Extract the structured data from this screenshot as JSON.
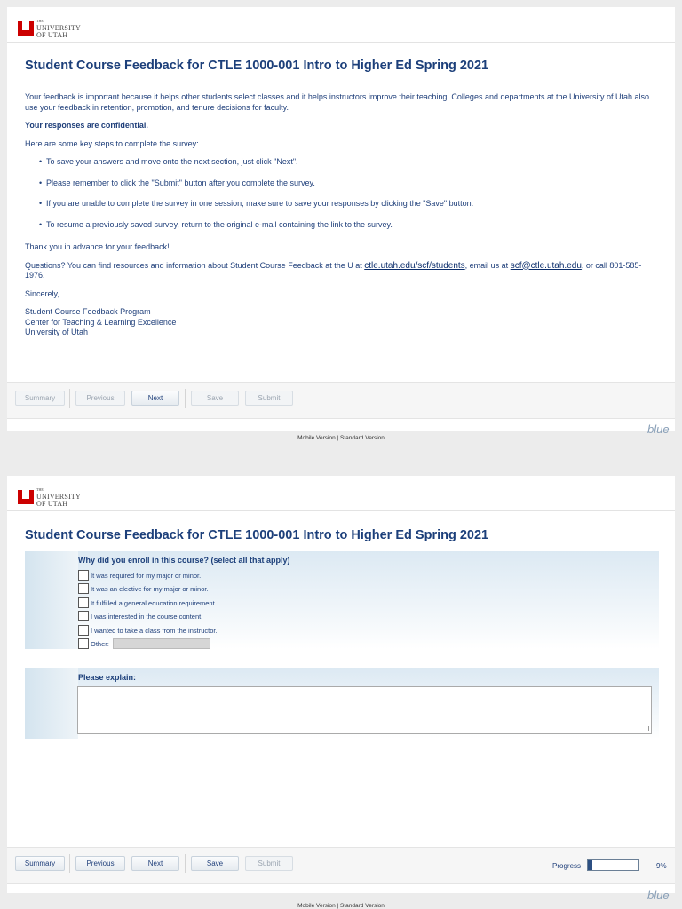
{
  "logo": {
    "the": "THE",
    "line1": "UNIVERSITY",
    "line2": "OF UTAH"
  },
  "title": "Student Course Feedback for CTLE 1000-001 Intro to Higher Ed Spring 2021",
  "intro": {
    "p1": "Your feedback is important because it helps other students select classes and it helps instructors improve their teaching. Colleges and departments at the University of Utah also use your feedback in retention, promotion, and tenure decisions for faculty.",
    "confidential": "Your responses are confidential.",
    "steps_heading": "Here are some key steps to complete the survey:",
    "steps": [
      "To save your answers and move onto the next section, just click \"Next\".",
      "Please remember to click the \"Submit\" button after you complete the survey.",
      "If you are unable to complete the survey in one session, make sure to save your responses by clicking the \"Save\" button.",
      "To resume a previously saved survey, return to the original e-mail containing the link to the survey."
    ],
    "thanks": "Thank you in advance for your feedback!",
    "questions_pre": "Questions? You can find resources and information about Student Course Feedback at the U at ",
    "questions_link1": "ctle.utah.edu/scf/students",
    "questions_mid": ", email us at ",
    "questions_link2": "scf@ctle.utah.edu",
    "questions_post": ", or call 801-585-1976.",
    "sincerely": "Sincerely,",
    "sign1": "Student Course Feedback Program",
    "sign2": "Center for Teaching & Learning Excellence",
    "sign3": "University of Utah"
  },
  "buttons": {
    "summary": "Summary",
    "previous": "Previous",
    "next": "Next",
    "save": "Save",
    "submit": "Submit"
  },
  "footer": {
    "links": "Mobile Version | Standard Version",
    "brand": "blue"
  },
  "q1": {
    "label": "Why did you enroll in this course? (select all that apply)",
    "options": [
      "It was required for my major or minor.",
      "It was an elective for my major or minor.",
      "It fulfilled a general education requirement.",
      "I was interested in the course content.",
      "I wanted to take a class from the instructor.",
      "Other:"
    ]
  },
  "q2": {
    "label": "Please explain:"
  },
  "progress": {
    "label": "Progress",
    "value": "9%",
    "fraction": 0.09
  }
}
